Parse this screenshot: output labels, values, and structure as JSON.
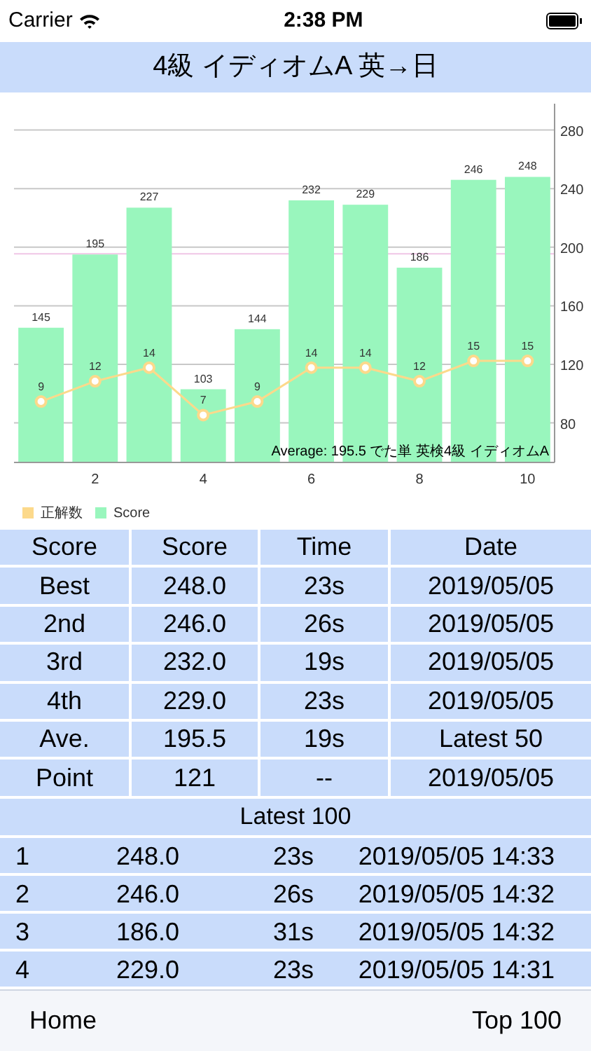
{
  "status_bar": {
    "carrier": "Carrier",
    "time": "2:38 PM"
  },
  "title": "4級 イディオムA 英→日",
  "chart": {
    "chart_data": {
      "type": "bar",
      "x": [
        1,
        2,
        3,
        4,
        5,
        6,
        7,
        8,
        9,
        10
      ],
      "xlim": [
        0.5,
        10.5
      ],
      "xticks": [
        2,
        4,
        6,
        8,
        10
      ],
      "yticks": [
        80,
        120,
        160,
        200,
        240,
        280
      ],
      "ylim": [
        53,
        298
      ],
      "grid": true,
      "data_labels": true,
      "series": [
        {
          "name": "Score",
          "color": "#99f6bd",
          "values": [
            145,
            195,
            227,
            103,
            144,
            232,
            229,
            186,
            246,
            248
          ]
        }
      ],
      "ref_lines": [
        {
          "axis": "y",
          "value": 195.5,
          "color": "#f0c6e6"
        }
      ]
    },
    "caption": "Average: 195.5   でた単 英検4級 イディオムA"
  },
  "count_chart": {
    "chart_data": {
      "type": "line",
      "data_labels": true,
      "series": [
        {
          "name": "正解数",
          "color": "#fcd98b",
          "marker": true,
          "values": [
            9,
            12,
            14,
            7,
            9,
            14,
            14,
            12,
            15,
            15
          ]
        }
      ]
    }
  },
  "summary": {
    "columns": [
      "Score",
      "Score",
      "Time",
      "Date"
    ],
    "rows": [
      [
        "Best",
        "248.0",
        "23s",
        "2019/05/05"
      ],
      [
        "2nd",
        "246.0",
        "26s",
        "2019/05/05"
      ],
      [
        "3rd",
        "232.0",
        "19s",
        "2019/05/05"
      ],
      [
        "4th",
        "229.0",
        "23s",
        "2019/05/05"
      ],
      [
        "Ave.",
        "195.5",
        "19s",
        "Latest 50"
      ],
      [
        "Point",
        "121",
        "--",
        "2019/05/05"
      ]
    ]
  },
  "latest": {
    "title": "Latest 100",
    "rows": [
      [
        "1",
        "248.0",
        "23s",
        "2019/05/05 14:33"
      ],
      [
        "2",
        "246.0",
        "26s",
        "2019/05/05 14:32"
      ],
      [
        "3",
        "186.0",
        "31s",
        "2019/05/05 14:32"
      ],
      [
        "4",
        "229.0",
        "23s",
        "2019/05/05 14:31"
      ]
    ]
  },
  "toolbar": {
    "left": "Home",
    "right": "Top 100"
  }
}
